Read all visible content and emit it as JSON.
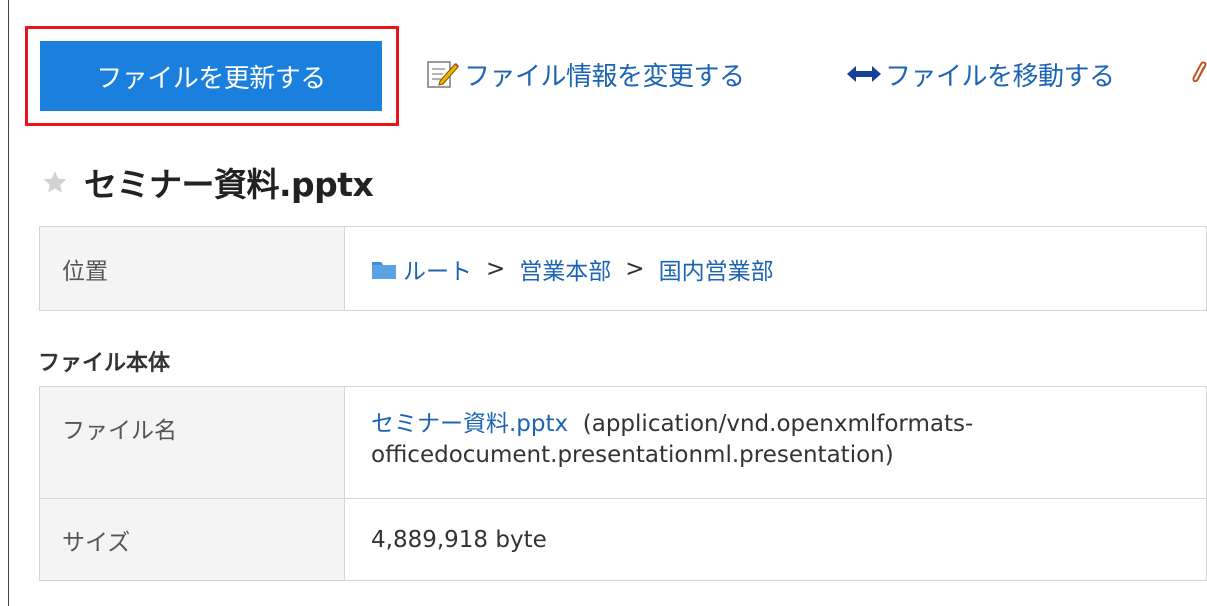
{
  "toolbar": {
    "update_button": "ファイルを更新する",
    "edit_info_link": "ファイル情報を変更する",
    "move_link": "ファイルを移動する"
  },
  "file": {
    "title": "セミナー資料.pptx"
  },
  "location": {
    "label": "位置",
    "path": [
      "ルート",
      "営業本部",
      "国内営業部"
    ],
    "separator": ">"
  },
  "file_body": {
    "section_title": "ファイル本体",
    "name_label": "ファイル名",
    "name_value": "セミナー資料.pptx",
    "mime_line1": "(application/vnd.openxmlformats-",
    "mime_line2": "officedocument.presentationml.presentation)",
    "size_label": "サイズ",
    "size_value": "4,889,918 byte"
  },
  "colors": {
    "accent": "#1b7fdd",
    "link": "#1c64b4",
    "highlight_border": "#e8141b"
  },
  "icons": [
    "edit-icon",
    "move-arrows-icon",
    "star-icon",
    "folder-icon",
    "paperclip-icon"
  ]
}
